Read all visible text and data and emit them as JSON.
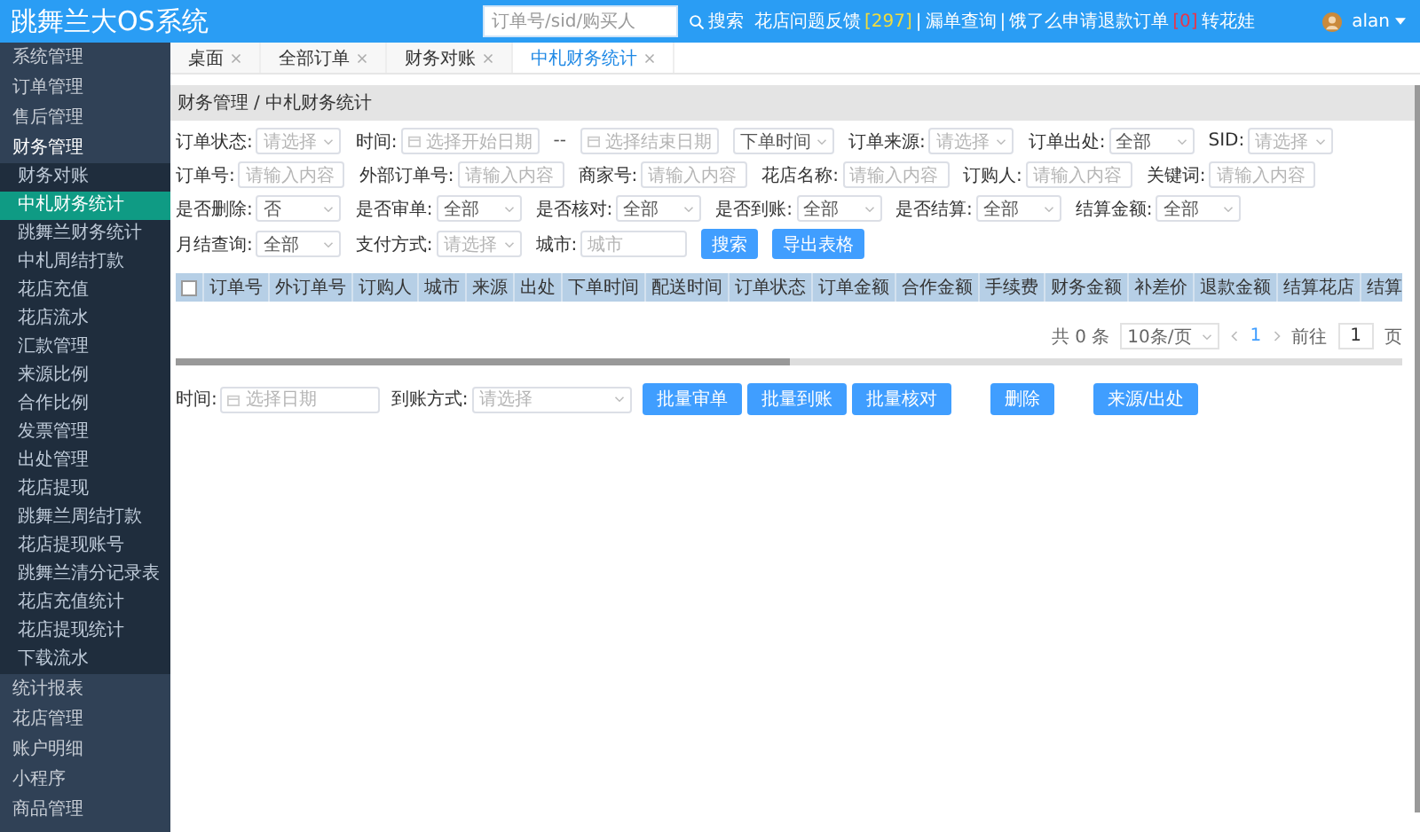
{
  "header": {
    "title": "跳舞兰大OS系统",
    "search": {
      "placeholder": "订单号/sid/购买人"
    },
    "search_button": "搜索",
    "notice": [
      {
        "kind": "link",
        "text": "花店问题反馈"
      },
      {
        "kind": "count",
        "text": "[297]",
        "color": "#f2dc3c"
      },
      {
        "kind": "sep",
        "text": "|"
      },
      {
        "kind": "link",
        "text": "漏单查询"
      },
      {
        "kind": "sep",
        "text": "|"
      },
      {
        "kind": "link",
        "text": "饿了么申请退款订单"
      },
      {
        "kind": "count",
        "text": "[0]",
        "color": "#e8364a"
      },
      {
        "kind": "link",
        "text": "转花娃"
      }
    ],
    "user": "alan"
  },
  "sidebar": {
    "items": [
      {
        "label": "系统管理",
        "expanded": false
      },
      {
        "label": "订单管理",
        "expanded": false
      },
      {
        "label": "售后管理",
        "expanded": false
      },
      {
        "label": "财务管理",
        "expanded": true,
        "children": [
          {
            "label": "财务对账",
            "selected": false
          },
          {
            "label": "中札财务统计",
            "selected": true
          },
          {
            "label": "跳舞兰财务统计",
            "selected": false
          },
          {
            "label": "中札周结打款",
            "selected": false
          },
          {
            "label": "花店充值",
            "selected": false
          },
          {
            "label": "花店流水",
            "selected": false
          },
          {
            "label": "汇款管理",
            "selected": false
          },
          {
            "label": "来源比例",
            "selected": false
          },
          {
            "label": "合作比例",
            "selected": false
          },
          {
            "label": "发票管理",
            "selected": false
          },
          {
            "label": "出处管理",
            "selected": false
          },
          {
            "label": "花店提现",
            "selected": false
          },
          {
            "label": "跳舞兰周结打款",
            "selected": false
          },
          {
            "label": "花店提现账号",
            "selected": false
          },
          {
            "label": "跳舞兰清分记录表",
            "selected": false
          },
          {
            "label": "花店充值统计",
            "selected": false
          },
          {
            "label": "花店提现统计",
            "selected": false
          },
          {
            "label": "下载流水",
            "selected": false
          }
        ]
      },
      {
        "label": "统计报表",
        "expanded": false
      },
      {
        "label": "花店管理",
        "expanded": false
      },
      {
        "label": "账户明细",
        "expanded": false
      },
      {
        "label": "小程序",
        "expanded": false
      },
      {
        "label": "商品管理",
        "expanded": false
      }
    ]
  },
  "tabs": [
    {
      "label": "桌面",
      "selected": false
    },
    {
      "label": "全部订单",
      "selected": false
    },
    {
      "label": "财务对账",
      "selected": false
    },
    {
      "label": "中札财务统计",
      "selected": true
    }
  ],
  "breadcrumb": {
    "items": [
      "财务管理",
      "中札财务统计"
    ],
    "separator": "/"
  },
  "filters": [
    {
      "label": "订单状态:",
      "kind": "select",
      "placeholder": "请选择"
    },
    {
      "label": "时间:",
      "kind": "date",
      "placeholder": "选择开始日期"
    },
    {
      "kind": "sep",
      "text": "--"
    },
    {
      "kind": "date",
      "placeholder": "选择结束日期"
    },
    {
      "kind": "select",
      "value": "下单时间"
    },
    {
      "label": "订单来源:",
      "kind": "select",
      "placeholder": "请选择"
    },
    {
      "label": "订单出处:",
      "kind": "select",
      "value": "全部"
    },
    {
      "label": "SID:",
      "kind": "select",
      "placeholder": "请选择"
    },
    {
      "label": "订单号:",
      "kind": "input",
      "placeholder": "请输入内容"
    },
    {
      "label": "外部订单号:",
      "kind": "input",
      "placeholder": "请输入内容"
    },
    {
      "label": "商家号:",
      "kind": "input",
      "placeholder": "请输入内容"
    },
    {
      "label": "花店名称:",
      "kind": "input",
      "placeholder": "请输入内容"
    },
    {
      "label": "订购人:",
      "kind": "input",
      "placeholder": "请输入内容"
    },
    {
      "label": "关键词:",
      "kind": "input",
      "placeholder": "请输入内容"
    },
    {
      "label": "是否删除:",
      "kind": "select",
      "value": "否"
    },
    {
      "label": "是否审单:",
      "kind": "select",
      "value": "全部"
    },
    {
      "label": "是否核对:",
      "kind": "select",
      "value": "全部"
    },
    {
      "label": "是否到账:",
      "kind": "select",
      "value": "全部"
    },
    {
      "label": "是否结算:",
      "kind": "select",
      "value": "全部"
    },
    {
      "label": "结算金额:",
      "kind": "select",
      "value": "全部"
    },
    {
      "label": "月结查询:",
      "kind": "select",
      "value": "全部"
    },
    {
      "label": "支付方式:",
      "kind": "select",
      "placeholder": "请选择"
    },
    {
      "label": "城市:",
      "kind": "input",
      "placeholder": "城市"
    },
    {
      "kind": "button",
      "text": "搜索"
    },
    {
      "kind": "button",
      "text": "导出表格"
    }
  ],
  "table": {
    "columns": [
      "订单号",
      "外订单号",
      "订购人",
      "城市",
      "来源",
      "出处",
      "下单时间",
      "配送时间",
      "订单状态",
      "订单金额",
      "合作金额",
      "手续费",
      "财务金额",
      "补差价",
      "退款金额",
      "结算花店",
      "结算"
    ],
    "select_all": {
      "checked": false
    }
  },
  "pagination": {
    "total": "共 0 条",
    "page_size": "10条/页",
    "pages": [
      {
        "label": "1",
        "selected": true
      }
    ],
    "goto": "前往",
    "page_input": "1",
    "page_unit": "页"
  },
  "actions": {
    "fields": [
      {
        "label": "时间:",
        "kind": "date",
        "placeholder": "选择日期"
      },
      {
        "label": "到账方式:",
        "kind": "select",
        "placeholder": "请选择"
      }
    ],
    "button_groups": [
      [
        "批量审单",
        "批量到账",
        "批量核对"
      ],
      [
        "删除"
      ],
      [
        "来源/出处"
      ]
    ]
  }
}
